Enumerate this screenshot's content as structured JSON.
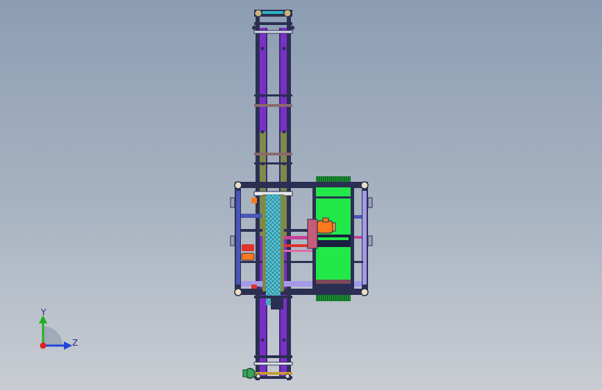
{
  "viewport": {
    "background_top": "#8c9db3",
    "background_bottom": "#c9cdd3"
  },
  "model": {
    "colors": {
      "frame_dark": "#2b2f52",
      "rail_purple": "#7a2fc8",
      "rail_olive": "#7d8a4a",
      "mesh_cyan": "#53c7d6",
      "panel_green": "#23e84a",
      "motor_orange": "#ff7a1a",
      "accent_red": "#e0332a",
      "accent_magenta": "#c8409a",
      "frame_blue": "#4a56b8",
      "frame_lilac": "#a59ae8"
    }
  },
  "triad": {
    "y_label": "Y",
    "z_label": "Z",
    "y_color": "#22b022",
    "z_color": "#2244dd",
    "origin_color": "#dd2222"
  }
}
